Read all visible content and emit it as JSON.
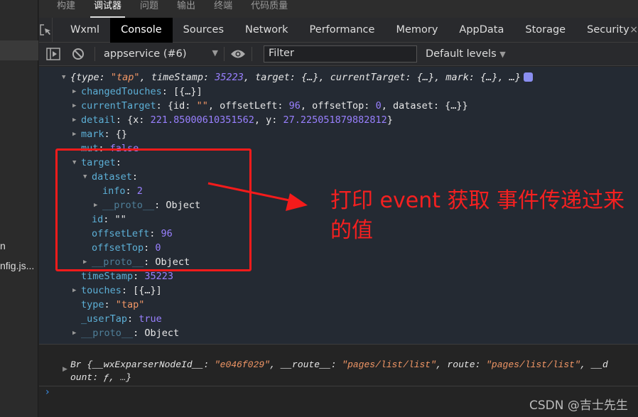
{
  "sidebar": {
    "files": [
      "n",
      "nfig.js..."
    ]
  },
  "top_tabs": [
    {
      "label": "构建"
    },
    {
      "label": "调试器",
      "active": true
    },
    {
      "label": "问题"
    },
    {
      "label": "输出"
    },
    {
      "label": "终端"
    },
    {
      "label": "代码质量"
    }
  ],
  "devtools_tabs": [
    {
      "label": "Wxml"
    },
    {
      "label": "Console",
      "active": true
    },
    {
      "label": "Sources"
    },
    {
      "label": "Network"
    },
    {
      "label": "Performance"
    },
    {
      "label": "Memory"
    },
    {
      "label": "AppData"
    },
    {
      "label": "Storage"
    },
    {
      "label": "Security"
    }
  ],
  "toolbar": {
    "context": "appservice (#6)",
    "filter_placeholder": "Filter",
    "levels": "Default levels",
    "close": "×"
  },
  "colors": {
    "key": "#5db0d7",
    "number": "#9980ff",
    "string": "#f29766",
    "annotation": "#f52020"
  },
  "console_lines": [
    {
      "indent": 0,
      "arrow": "down",
      "italic": true,
      "info": true,
      "segs": [
        [
          "{",
          "p"
        ],
        [
          "type",
          "p"
        ],
        [
          ": ",
          "p"
        ],
        [
          "\"tap\"",
          "s"
        ],
        [
          ", timeStamp: ",
          "p"
        ],
        [
          "35223",
          "n"
        ],
        [
          ", target: {…}, currentTarget: {…}, mark: {…}, …}",
          "p"
        ]
      ]
    },
    {
      "indent": 1,
      "arrow": "right",
      "segs": [
        [
          "changedTouches",
          "k"
        ],
        [
          ": [{…}]",
          "p"
        ]
      ]
    },
    {
      "indent": 1,
      "arrow": "right",
      "segs": [
        [
          "currentTarget",
          "k"
        ],
        [
          ": {id: ",
          "p"
        ],
        [
          "\"\"",
          "s"
        ],
        [
          ", offsetLeft: ",
          "p"
        ],
        [
          "96",
          "n"
        ],
        [
          ", offsetTop: ",
          "p"
        ],
        [
          "0",
          "n"
        ],
        [
          ", dataset: {…}}",
          "p"
        ]
      ]
    },
    {
      "indent": 1,
      "arrow": "right",
      "segs": [
        [
          "detail",
          "k"
        ],
        [
          ": {x: ",
          "p"
        ],
        [
          "221.85000610351562",
          "n"
        ],
        [
          ", y: ",
          "p"
        ],
        [
          "27.225051879882812",
          "n"
        ],
        [
          "}",
          "p"
        ]
      ]
    },
    {
      "indent": 1,
      "arrow": "right",
      "segs": [
        [
          "mark",
          "k"
        ],
        [
          ": {}",
          "p"
        ]
      ]
    },
    {
      "indent": 1,
      "arrow": "",
      "segs": [
        [
          "mut",
          "k"
        ],
        [
          ": ",
          "p"
        ],
        [
          "false",
          "n"
        ]
      ]
    },
    {
      "indent": 1,
      "arrow": "down",
      "segs": [
        [
          "target",
          "k"
        ],
        [
          ":",
          "p"
        ]
      ]
    },
    {
      "indent": 2,
      "arrow": "down",
      "segs": [
        [
          "dataset",
          "k"
        ],
        [
          ":",
          "p"
        ]
      ]
    },
    {
      "indent": 3,
      "arrow": "",
      "segs": [
        [
          "info",
          "k"
        ],
        [
          ": ",
          "p"
        ],
        [
          "2",
          "n"
        ]
      ]
    },
    {
      "indent": 3,
      "arrow": "right",
      "segs": [
        [
          "__proto__",
          "d"
        ],
        [
          ": Object",
          "p"
        ]
      ]
    },
    {
      "indent": 2,
      "arrow": "",
      "segs": [
        [
          "id",
          "k"
        ],
        [
          ": \"\"",
          "p"
        ]
      ]
    },
    {
      "indent": 2,
      "arrow": "",
      "segs": [
        [
          "offsetLeft",
          "k"
        ],
        [
          ": ",
          "p"
        ],
        [
          "96",
          "n"
        ]
      ]
    },
    {
      "indent": 2,
      "arrow": "",
      "segs": [
        [
          "offsetTop",
          "k"
        ],
        [
          ": ",
          "p"
        ],
        [
          "0",
          "n"
        ]
      ]
    },
    {
      "indent": 2,
      "arrow": "right",
      "segs": [
        [
          "__proto__",
          "d"
        ],
        [
          ": Object",
          "p"
        ]
      ]
    },
    {
      "indent": 1,
      "arrow": "",
      "segs": [
        [
          "timeStamp",
          "k"
        ],
        [
          ": ",
          "p"
        ],
        [
          "35223",
          "n"
        ]
      ]
    },
    {
      "indent": 1,
      "arrow": "right",
      "segs": [
        [
          "touches",
          "k"
        ],
        [
          ": [{…}]",
          "p"
        ]
      ]
    },
    {
      "indent": 1,
      "arrow": "",
      "segs": [
        [
          "type",
          "k"
        ],
        [
          ": ",
          "p"
        ],
        [
          "\"tap\"",
          "s"
        ]
      ]
    },
    {
      "indent": 1,
      "arrow": "",
      "segs": [
        [
          "_userTap",
          "k"
        ],
        [
          ": ",
          "p"
        ],
        [
          "true",
          "n"
        ]
      ]
    },
    {
      "indent": 1,
      "arrow": "right",
      "segs": [
        [
          "__proto__",
          "d"
        ],
        [
          ": Object",
          "p"
        ]
      ]
    }
  ],
  "br_lines": [
    [
      [
        "Br {__wxExparserNodeId__: ",
        "p"
      ],
      [
        "\"e046f029\"",
        "s"
      ],
      [
        ", __route__: ",
        "p"
      ],
      [
        "\"pages/list/list\"",
        "s"
      ],
      [
        ", route: ",
        "p"
      ],
      [
        "\"pages/list/list\"",
        "s"
      ],
      [
        ", __d",
        "p"
      ]
    ],
    [
      [
        "ount: ƒ, …}",
        "p"
      ]
    ]
  ],
  "prompt": "›",
  "annotation": "打印 event 获取 事件传递过来的值",
  "watermark": "CSDN @吉士先生"
}
